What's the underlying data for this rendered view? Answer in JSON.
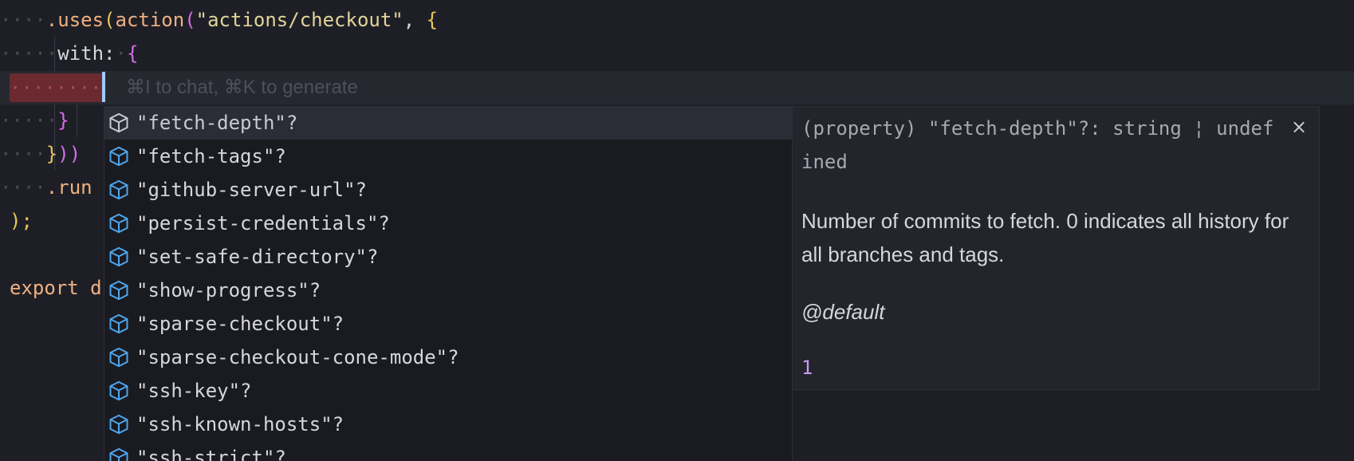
{
  "editor": {
    "line1": {
      "ws": "····",
      "method": ".uses",
      "paren": "(",
      "fn": "action",
      "paren2": "(",
      "str": "\"actions/checkout\"",
      "comma": ", ",
      "brace": "{"
    },
    "line2": {
      "ws": "·····",
      "key": "with:",
      "ws2": "·",
      "brace": "{"
    },
    "line4": {
      "ws": "·····",
      "brace": "}"
    },
    "line5": {
      "ws": "····",
      "brace": "}",
      "parens": "))"
    },
    "line6": {
      "ws": "····",
      "method": ".run"
    },
    "line7": {
      "text": ");"
    },
    "line9": {
      "kw": "export",
      "rest": " d"
    },
    "red_dots": "········",
    "ghost_hint": "⌘I to chat, ⌘K to generate"
  },
  "suggest": {
    "items": [
      {
        "label": "\"fetch-depth\"?",
        "icon": "cube-icon"
      },
      {
        "label": "\"fetch-tags\"?",
        "icon": "cube-icon"
      },
      {
        "label": "\"github-server-url\"?",
        "icon": "cube-icon"
      },
      {
        "label": "\"persist-credentials\"?",
        "icon": "cube-icon"
      },
      {
        "label": "\"set-safe-directory\"?",
        "icon": "cube-icon"
      },
      {
        "label": "\"show-progress\"?",
        "icon": "cube-icon"
      },
      {
        "label": "\"sparse-checkout\"?",
        "icon": "cube-icon"
      },
      {
        "label": "\"sparse-checkout-cone-mode\"?",
        "icon": "cube-icon"
      },
      {
        "label": "\"ssh-key\"?",
        "icon": "cube-icon"
      },
      {
        "label": "\"ssh-known-hosts\"?",
        "icon": "cube-icon"
      },
      {
        "label": "\"ssh-strict\"?",
        "icon": "cube-icon"
      }
    ],
    "selected_index": 0
  },
  "details": {
    "signature": "(property) \"fetch-depth\"?: string ¦ undefined",
    "description": "Number of commits to fetch. 0 indicates all history for all branches and tags.",
    "tag": "@default",
    "default_value": "1",
    "close_label": "×"
  },
  "colors": {
    "background": "#1e1f26",
    "icon_blue": "#4fa6ed",
    "string": "#e3d49a",
    "function": "#efb080",
    "number": "#c79bf0"
  }
}
